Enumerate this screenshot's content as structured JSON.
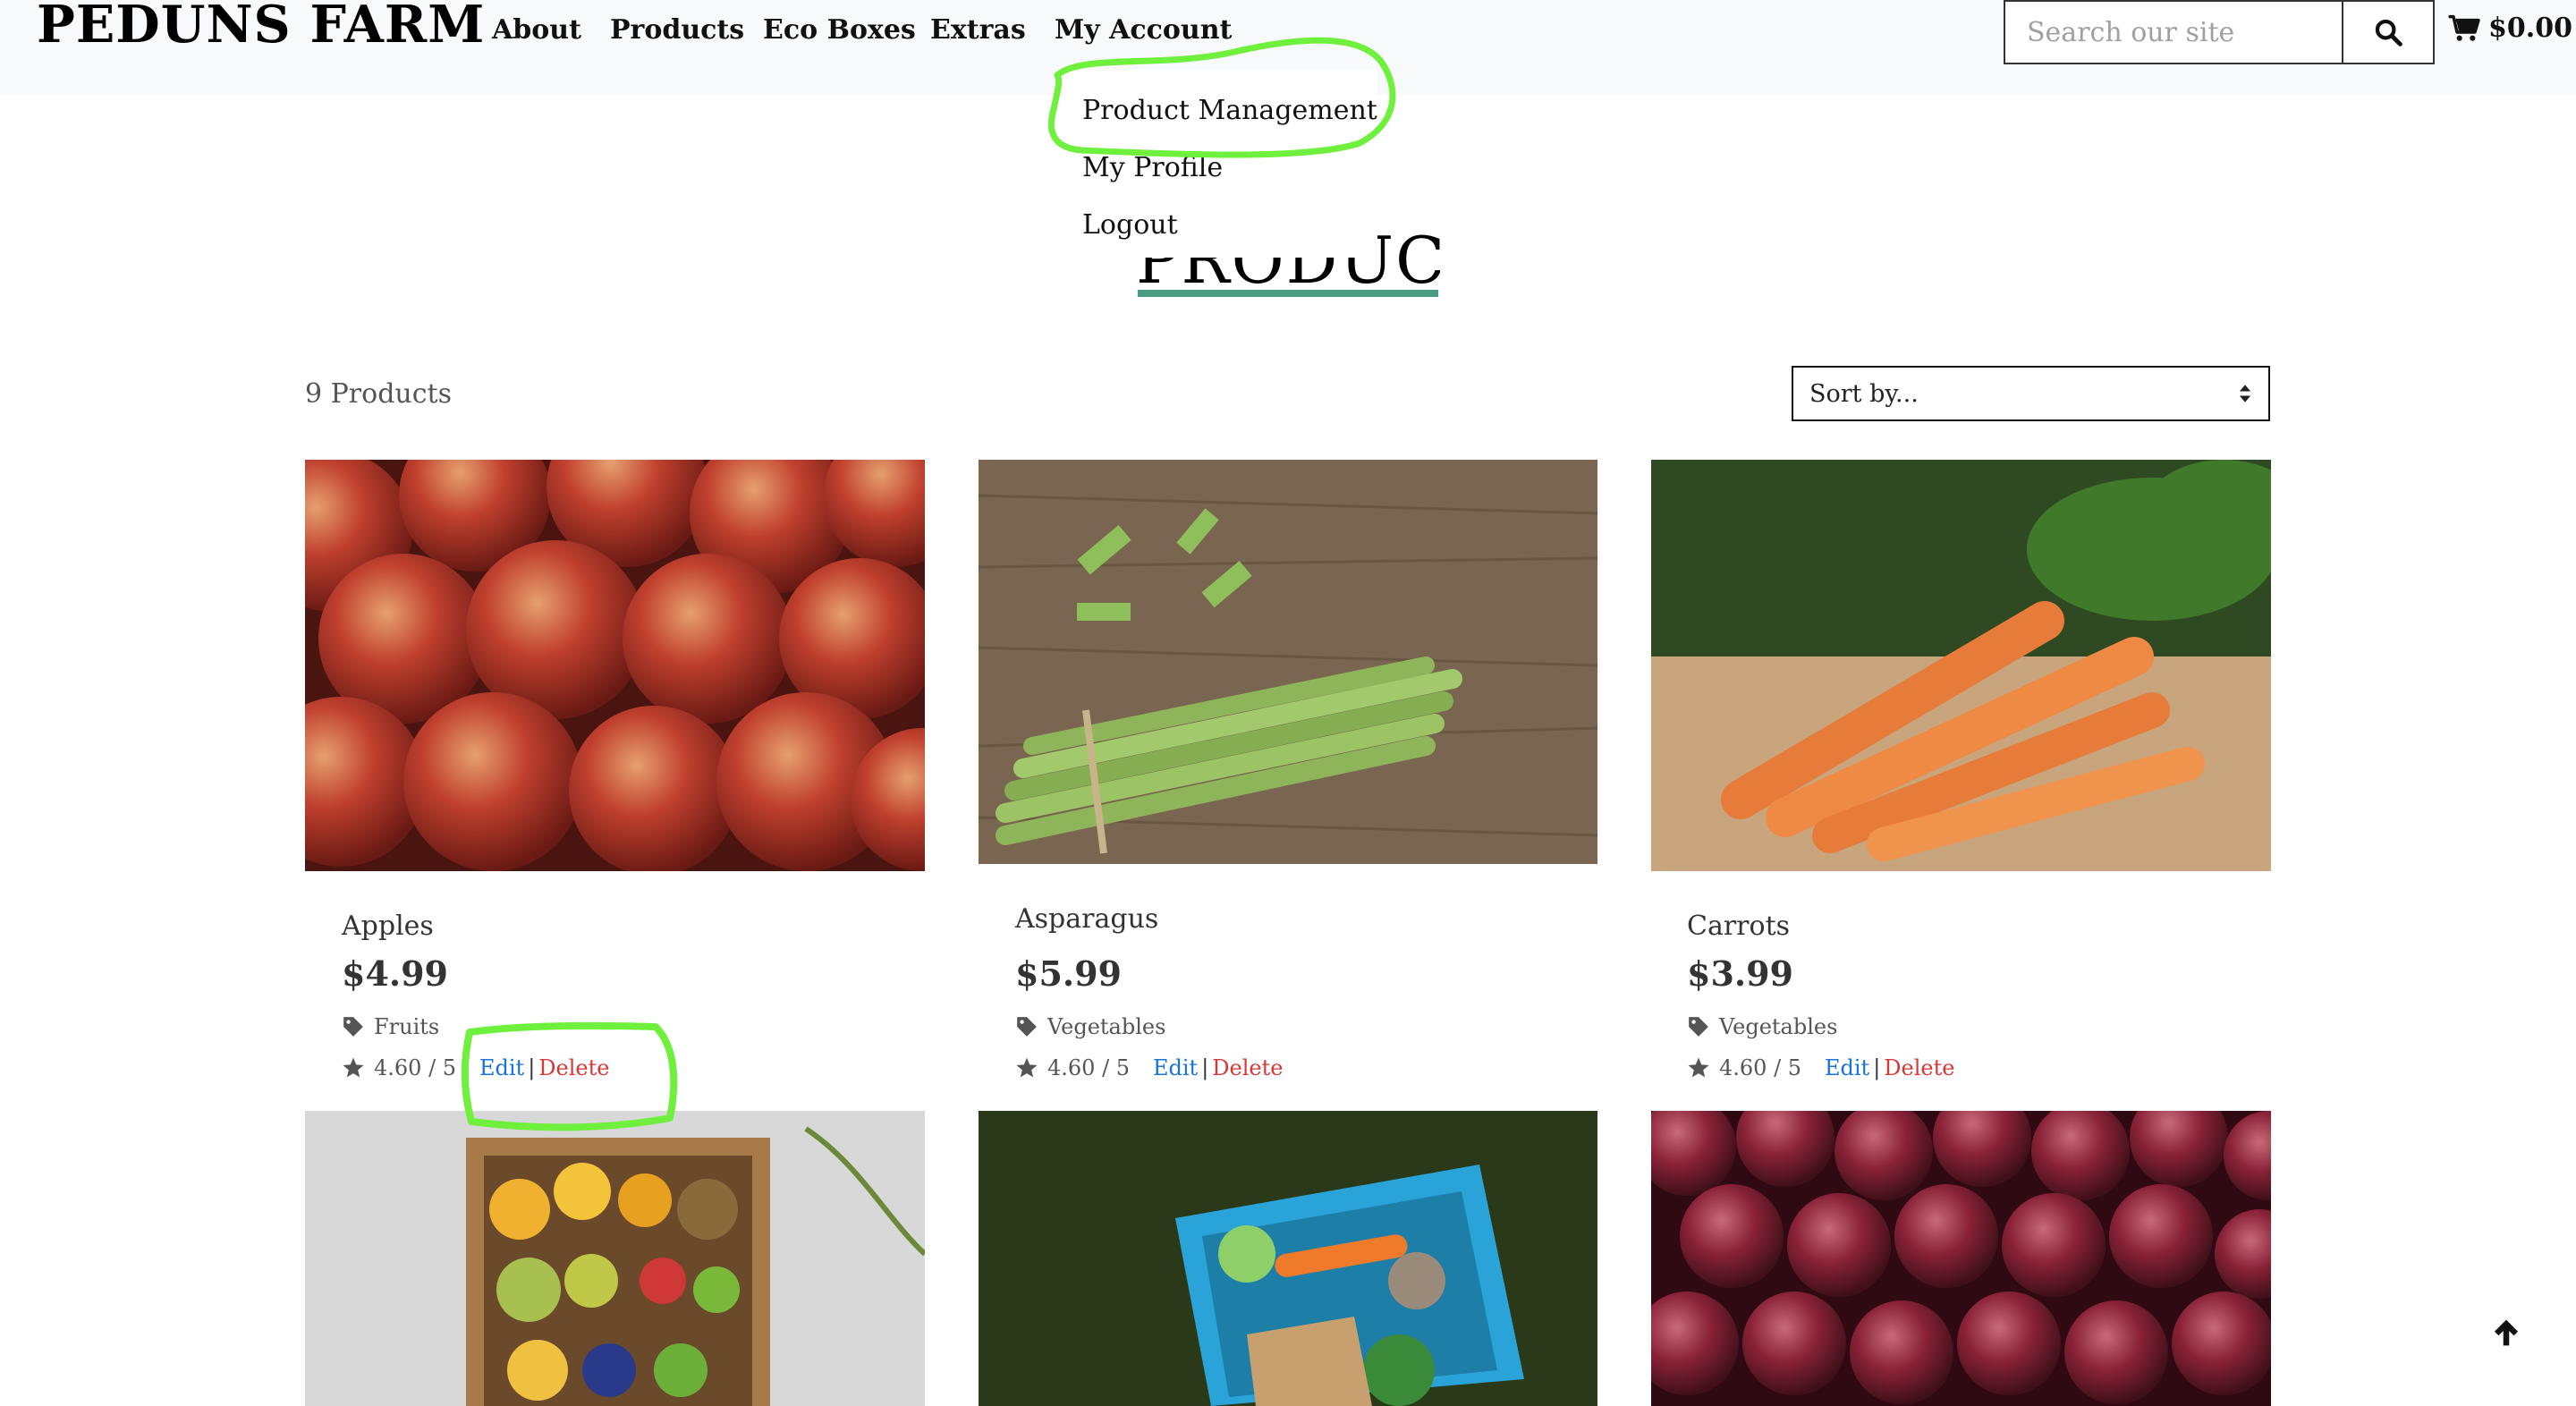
{
  "header": {
    "logo": "PEDUNS FARM",
    "nav": [
      "About",
      "Products",
      "Eco Boxes",
      "Extras",
      "My Account"
    ],
    "search_placeholder": "Search our site",
    "cart_total": "$0.00"
  },
  "account_menu": {
    "items": [
      "Product Management",
      "My Profile",
      "Logout"
    ]
  },
  "page": {
    "title": "PRODUCTS",
    "product_count": "9 Products",
    "sort_label": "Sort by..."
  },
  "products": [
    {
      "name": "Apples",
      "price": "$4.99",
      "category": "Fruits",
      "rating": "4.60 / 5",
      "edit": "Edit",
      "delete": "Delete"
    },
    {
      "name": "Asparagus",
      "price": "$5.99",
      "category": "Vegetables",
      "rating": "4.60 / 5",
      "edit": "Edit",
      "delete": "Delete"
    },
    {
      "name": "Carrots",
      "price": "$3.99",
      "category": "Vegetables",
      "rating": "4.60 / 5",
      "edit": "Edit",
      "delete": "Delete"
    }
  ],
  "colors": {
    "accent_underline": "#4a9b7f",
    "edit_link": "#1a73d9",
    "delete_link": "#d93636",
    "annotation": "#6ef03c"
  },
  "icons": [
    "search-icon",
    "cart-icon",
    "tag-icon",
    "star-icon",
    "arrow-up-icon"
  ]
}
